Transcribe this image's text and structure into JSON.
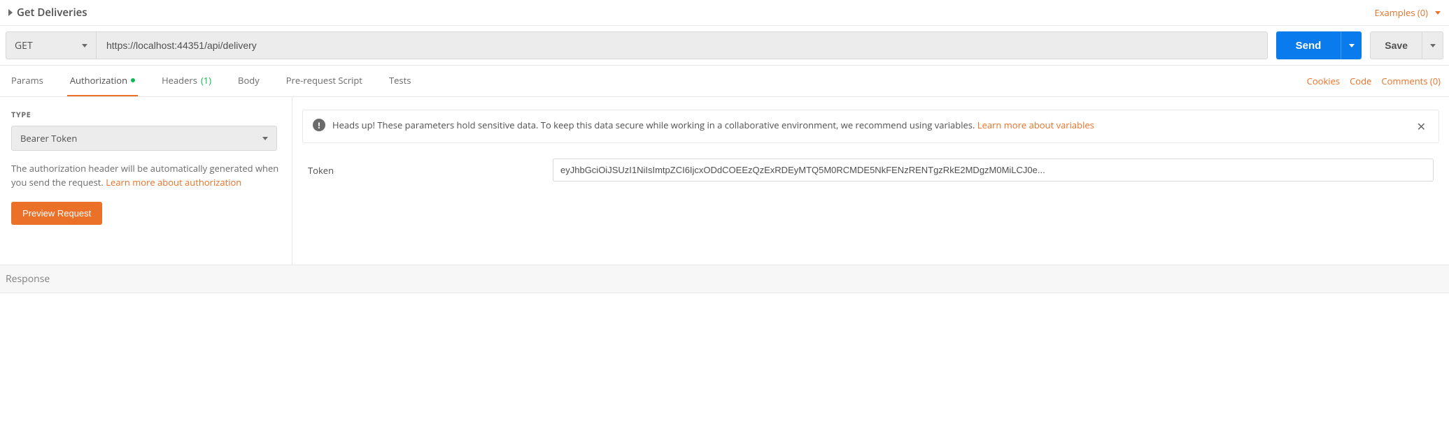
{
  "request": {
    "name": "Get Deliveries",
    "method": "GET",
    "url": "https://localhost:44351/api/delivery",
    "examples_label": "Examples (0)"
  },
  "actions": {
    "send": "Send",
    "save": "Save"
  },
  "tabs": {
    "params": "Params",
    "authorization": "Authorization",
    "headers": "Headers",
    "headers_count": "(1)",
    "body": "Body",
    "prerequest": "Pre-request Script",
    "tests": "Tests"
  },
  "right_links": {
    "cookies": "Cookies",
    "code": "Code",
    "comments": "Comments (0)"
  },
  "auth": {
    "type_label": "TYPE",
    "type_value": "Bearer Token",
    "description": "The authorization header will be automatically generated when you send the request. ",
    "learn_more": "Learn more about authorization",
    "preview_button": "Preview Request",
    "notice_text": "Heads up! These parameters hold sensitive data. To keep this data secure while working in a collaborative environment, we recommend using variables. ",
    "notice_link": "Learn more about variables",
    "token_label": "Token",
    "token_value": "eyJhbGciOiJSUzI1NiIsImtpZCI6IjcxODdCOEEzQzExRDEyMTQ5M0RCMDE5NkFENzRENTgzRkE2MDgzM0MiLCJ0e..."
  },
  "response": {
    "label": "Response"
  }
}
